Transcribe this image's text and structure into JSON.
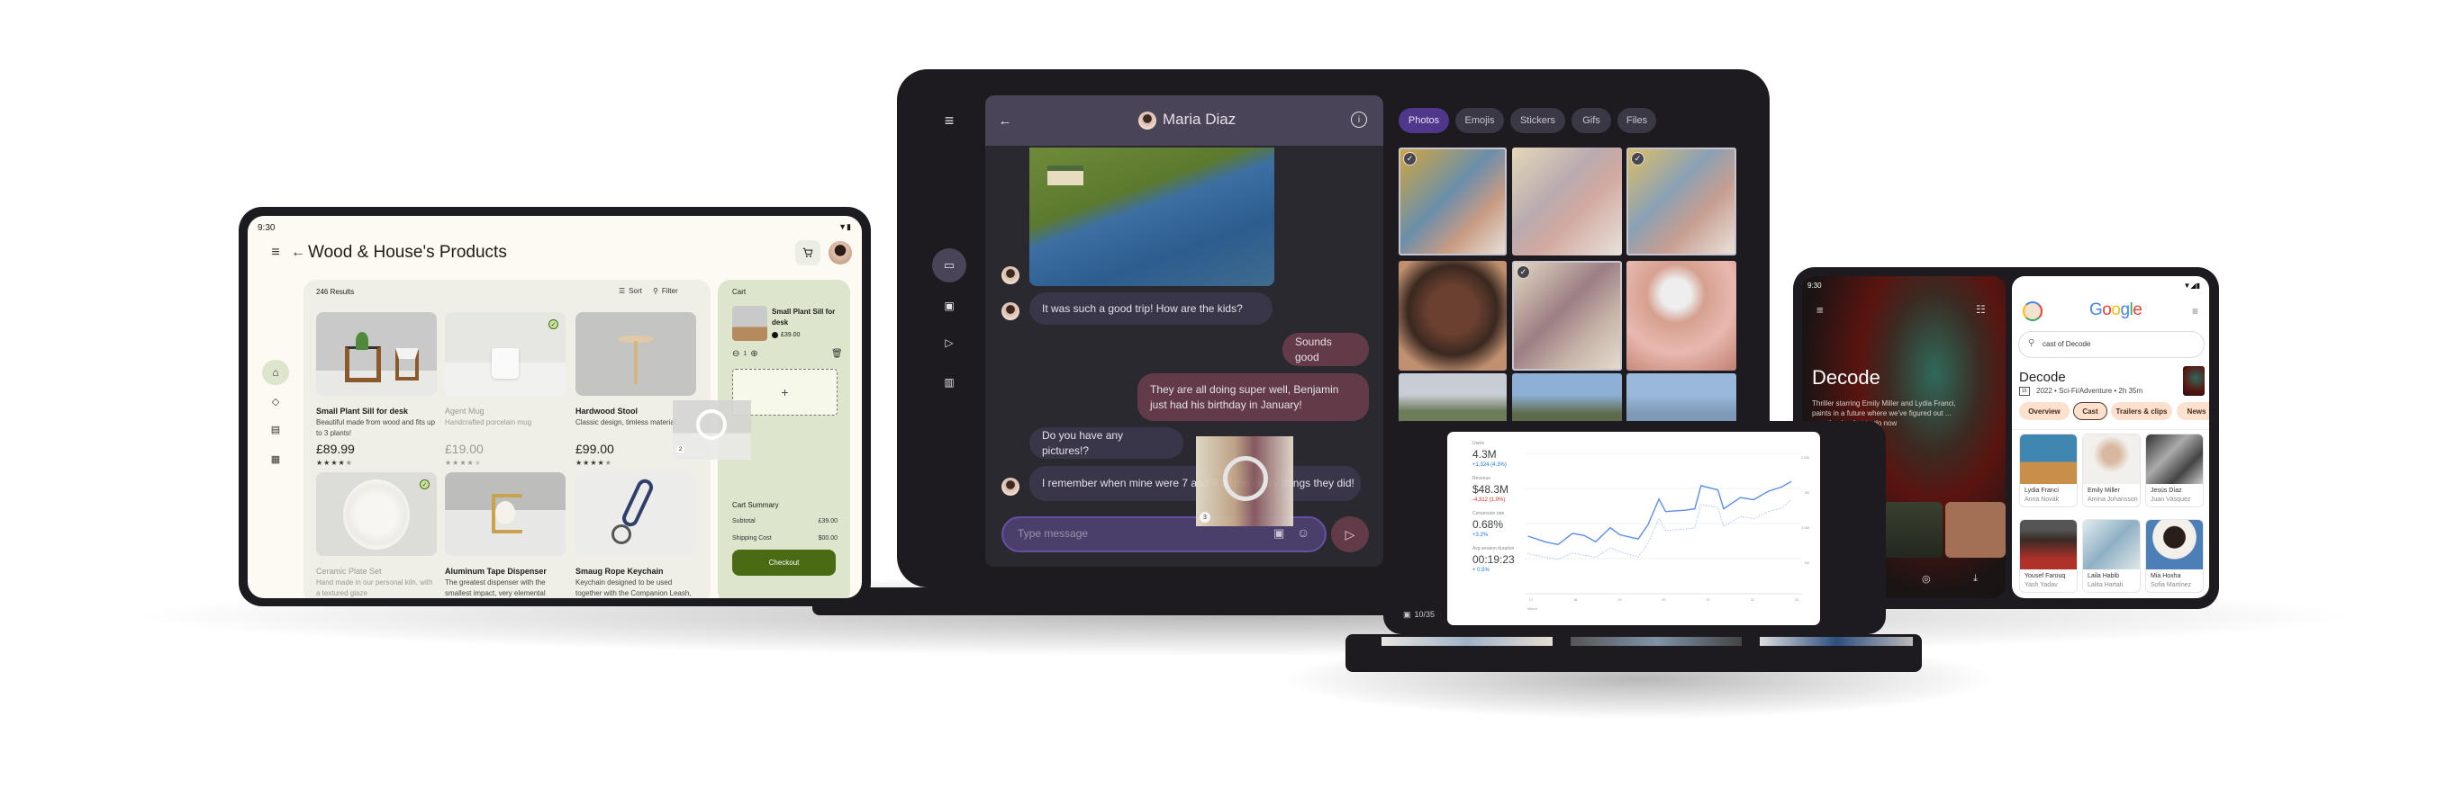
{
  "shop": {
    "status_time": "9:30",
    "title": "Wood & House's Products",
    "results": "246 Results",
    "sort": "Sort",
    "filter": "Filter",
    "products": [
      {
        "name": "Small Plant Sill for desk",
        "desc": "Beautiful made from wood and fits up to 3 plants!",
        "price": "£89.99",
        "rating": 4.5,
        "selected": false
      },
      {
        "name": "Agent Mug",
        "desc": "Handcrafted porcelain mug",
        "price": "£19.00",
        "rating": 4.5,
        "selected": true
      },
      {
        "name": "Hardwood Stool",
        "desc": "Classic design, timless material.",
        "price": "£99.00",
        "rating": 4.5,
        "selected": false
      },
      {
        "name": "Ceramic Plate Set",
        "desc": "Hand made in our personal kiln, with a textured glaze",
        "selected": true
      },
      {
        "name": "Aluminum Tape Dispenser",
        "desc": "The greatest dispenser with the smallest impact, very elemental",
        "selected": false
      },
      {
        "name": "Smaug Rope Keychain",
        "desc": "Keychain designed to be used together with the Companion Leash, perfect",
        "selected": false
      }
    ],
    "cart": {
      "title": "Cart",
      "item_name": "Small Plant Sill for desk",
      "item_price": "£39.00",
      "quantity": "1",
      "add": "+",
      "summary_title": "Cart Summary",
      "subtotal_label": "Subtotal",
      "subtotal": "£39.00",
      "shipping_label": "Shipping Cost",
      "shipping": "$00.00",
      "checkout": "Checkout"
    },
    "drag_badge": "2",
    "colors": {
      "accent": "#4a6b14",
      "cart_bg": "#dde6cc",
      "background": "#fdf9f3"
    }
  },
  "chat": {
    "contact": "Maria Diaz",
    "messages": [
      {
        "from": "them",
        "text": "It was such a good trip! How are the kids?"
      },
      {
        "from": "me",
        "text": "Sounds good"
      },
      {
        "from": "me",
        "text": "They are all doing super well, Benjamin just had his birthday in January!"
      },
      {
        "from": "them",
        "text": "Do you have any pictures!?"
      },
      {
        "from": "them",
        "text": "I remember when mine were 7 and 9 all the crazy things they did!"
      }
    ],
    "input_placeholder": "Type message",
    "drag_badge": "3",
    "tabs": [
      "Photos",
      "Emojis",
      "Stickers",
      "Gifs",
      "Files"
    ],
    "active_tab": "Photos",
    "colors": {
      "sent": "#633b48",
      "received": "#3a3649",
      "accent": "#4f378b"
    }
  },
  "movie": {
    "status_time": "9:30",
    "title": "Decode",
    "description": "Thriller starring Emily Miller and Lydia Franci, paints in a future where we've figured out ... question is what to do now"
  },
  "search": {
    "logo": "Google",
    "query": "cast of Decode",
    "result_title": "Decode",
    "rating": "15",
    "meta": "2022 • Sci-Fi/Adventure • 2h 35m",
    "chips": [
      "Overview",
      "Cast",
      "Trailers & clips",
      "News"
    ],
    "active_chip": "Cast",
    "cast": [
      {
        "name": "Lydia Franci",
        "role": "Anna Novák"
      },
      {
        "name": "Emily Miller",
        "role": "Amina Johansson"
      },
      {
        "name": "Jesús Díaz",
        "role": "Juan Vásquez"
      },
      {
        "name": "Yousef Farouq",
        "role": "Yash Yadav"
      },
      {
        "name": "Laila Habib",
        "role": "Lalita Hartati"
      },
      {
        "name": "Mia Hoxha",
        "role": "Sofia Martínez"
      }
    ]
  },
  "presentation": {
    "slide_counter": "10/35",
    "stats": [
      {
        "label": "Users",
        "value": "4.3M",
        "delta": "+1,324 (4.3%)",
        "trend": "up"
      },
      {
        "label": "Revenue",
        "value": "$48.3M",
        "delta": "-4,312 (1.9%)",
        "trend": "down"
      },
      {
        "label": "Conversion rate",
        "value": "0.68%",
        "delta": "+3.2%",
        "trend": "up"
      },
      {
        "label": "Avg session duration",
        "value": "00:19:23",
        "delta": "+ 0.5%",
        "trend": "up"
      }
    ]
  },
  "chart_data": {
    "type": "line",
    "xlabel": "March",
    "x_ticks": [
      "17",
      "18",
      "19",
      "20",
      "21",
      "22",
      "23"
    ],
    "y_ticks": [
      "2.5M",
      "2M",
      "1.5M",
      "1M"
    ],
    "xlim": [
      17,
      23
    ],
    "ylim": [
      0.5,
      2.5
    ],
    "grid": true,
    "x": [
      16.93,
      17.32,
      17.61,
      17.94,
      18.2,
      18.46,
      18.79,
      19.01,
      19.42,
      19.64,
      19.89,
      20.04,
      20.48,
      20.7,
      20.84,
      21.22,
      21.35,
      21.73,
      22.03,
      22.36,
      22.66,
      22.88
    ],
    "series": [
      {
        "style": "solid",
        "color": "#5b8def",
        "values": [
          1.32,
          1.24,
          1.2,
          1.36,
          1.33,
          1.24,
          1.44,
          1.34,
          1.28,
          1.48,
          1.85,
          1.67,
          1.69,
          1.71,
          2.04,
          1.98,
          1.71,
          1.87,
          1.84,
          1.96,
          2.02,
          2.1
        ]
      },
      {
        "style": "dotted",
        "color": "#a9c3f7",
        "values": [
          1.07,
          1.02,
          0.99,
          1.08,
          1.05,
          1.02,
          1.15,
          1.1,
          1.02,
          1.22,
          1.57,
          1.4,
          1.42,
          1.44,
          1.77,
          1.73,
          1.46,
          1.6,
          1.57,
          1.67,
          1.72,
          1.84
        ]
      }
    ]
  }
}
